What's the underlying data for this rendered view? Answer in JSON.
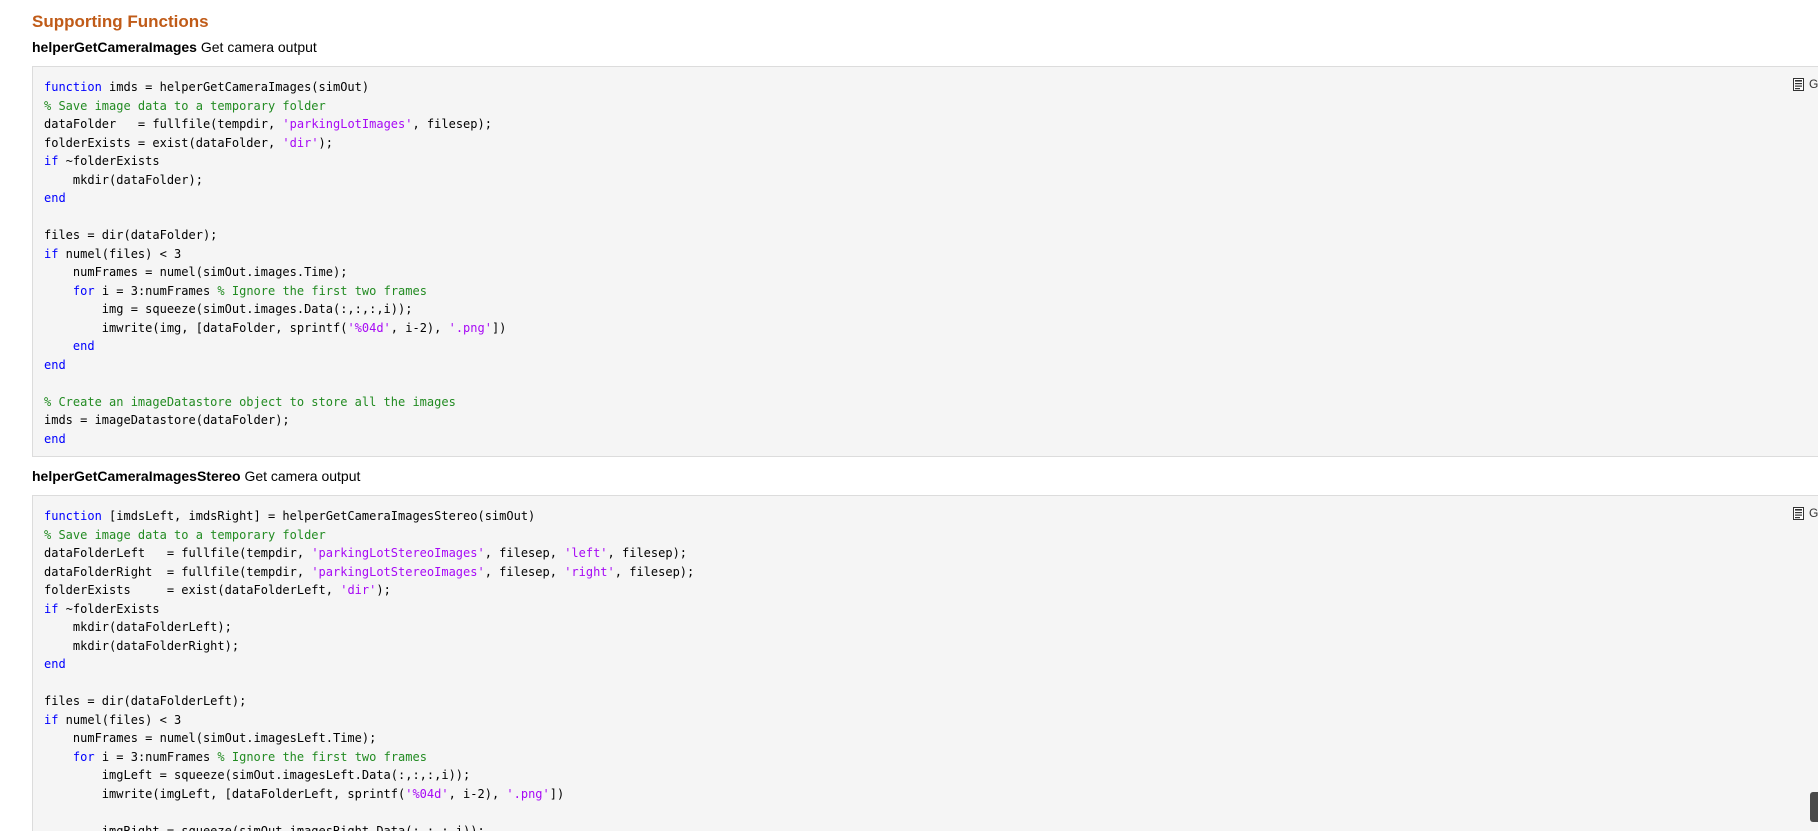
{
  "section_title": "Supporting Functions",
  "functions": [
    {
      "name": "helperGetCameraImages",
      "description": "Get camera output",
      "button_label": "Ge",
      "code_lines": [
        [
          {
            "t": "kw",
            "s": "function"
          },
          {
            "t": "plain",
            "s": " imds = helperGetCameraImages(simOut)"
          }
        ],
        [
          {
            "t": "cmt",
            "s": "% Save image data to a temporary folder"
          }
        ],
        [
          {
            "t": "plain",
            "s": "dataFolder   = fullfile(tempdir, "
          },
          {
            "t": "str",
            "s": "'parkingLotImages'"
          },
          {
            "t": "plain",
            "s": ", filesep);"
          }
        ],
        [
          {
            "t": "plain",
            "s": "folderExists = exist(dataFolder, "
          },
          {
            "t": "str",
            "s": "'dir'"
          },
          {
            "t": "plain",
            "s": ");"
          }
        ],
        [
          {
            "t": "kw",
            "s": "if"
          },
          {
            "t": "plain",
            "s": " ~folderExists"
          }
        ],
        [
          {
            "t": "plain",
            "s": "    mkdir(dataFolder);"
          }
        ],
        [
          {
            "t": "kw",
            "s": "end"
          }
        ],
        [],
        [
          {
            "t": "plain",
            "s": "files = dir(dataFolder);"
          }
        ],
        [
          {
            "t": "kw",
            "s": "if"
          },
          {
            "t": "plain",
            "s": " numel(files) < 3"
          }
        ],
        [
          {
            "t": "plain",
            "s": "    numFrames = numel(simOut.images.Time);"
          }
        ],
        [
          {
            "t": "plain",
            "s": "    "
          },
          {
            "t": "kw",
            "s": "for"
          },
          {
            "t": "plain",
            "s": " i = 3:numFrames "
          },
          {
            "t": "cmt",
            "s": "% Ignore the first two frames"
          }
        ],
        [
          {
            "t": "plain",
            "s": "        img = squeeze(simOut.images.Data(:,:,:,i));"
          }
        ],
        [
          {
            "t": "plain",
            "s": "        imwrite(img, [dataFolder, sprintf("
          },
          {
            "t": "str",
            "s": "'%04d'"
          },
          {
            "t": "plain",
            "s": ", i-2), "
          },
          {
            "t": "str",
            "s": "'.png'"
          },
          {
            "t": "plain",
            "s": "])"
          }
        ],
        [
          {
            "t": "plain",
            "s": "    "
          },
          {
            "t": "kw",
            "s": "end"
          }
        ],
        [
          {
            "t": "kw",
            "s": "end"
          }
        ],
        [],
        [
          {
            "t": "cmt",
            "s": "% Create an imageDatastore object to store all the images"
          }
        ],
        [
          {
            "t": "plain",
            "s": "imds = imageDatastore(dataFolder);"
          }
        ],
        [
          {
            "t": "kw",
            "s": "end"
          }
        ]
      ]
    },
    {
      "name": "helperGetCameraImagesStereo",
      "description": "Get camera output",
      "button_label": "Ge",
      "code_lines": [
        [
          {
            "t": "kw",
            "s": "function"
          },
          {
            "t": "plain",
            "s": " [imdsLeft, imdsRight] = helperGetCameraImagesStereo(simOut)"
          }
        ],
        [
          {
            "t": "cmt",
            "s": "% Save image data to a temporary folder"
          }
        ],
        [
          {
            "t": "plain",
            "s": "dataFolderLeft   = fullfile(tempdir, "
          },
          {
            "t": "str",
            "s": "'parkingLotStereoImages'"
          },
          {
            "t": "plain",
            "s": ", filesep, "
          },
          {
            "t": "str",
            "s": "'left'"
          },
          {
            "t": "plain",
            "s": ", filesep);"
          }
        ],
        [
          {
            "t": "plain",
            "s": "dataFolderRight  = fullfile(tempdir, "
          },
          {
            "t": "str",
            "s": "'parkingLotStereoImages'"
          },
          {
            "t": "plain",
            "s": ", filesep, "
          },
          {
            "t": "str",
            "s": "'right'"
          },
          {
            "t": "plain",
            "s": ", filesep);"
          }
        ],
        [
          {
            "t": "plain",
            "s": "folderExists     = exist(dataFolderLeft, "
          },
          {
            "t": "str",
            "s": "'dir'"
          },
          {
            "t": "plain",
            "s": ");"
          }
        ],
        [
          {
            "t": "kw",
            "s": "if"
          },
          {
            "t": "plain",
            "s": " ~folderExists"
          }
        ],
        [
          {
            "t": "plain",
            "s": "    mkdir(dataFolderLeft);"
          }
        ],
        [
          {
            "t": "plain",
            "s": "    mkdir(dataFolderRight);"
          }
        ],
        [
          {
            "t": "kw",
            "s": "end"
          }
        ],
        [],
        [
          {
            "t": "plain",
            "s": "files = dir(dataFolderLeft);"
          }
        ],
        [
          {
            "t": "kw",
            "s": "if"
          },
          {
            "t": "plain",
            "s": " numel(files) < 3"
          }
        ],
        [
          {
            "t": "plain",
            "s": "    numFrames = numel(simOut.imagesLeft.Time);"
          }
        ],
        [
          {
            "t": "plain",
            "s": "    "
          },
          {
            "t": "kw",
            "s": "for"
          },
          {
            "t": "plain",
            "s": " i = 3:numFrames "
          },
          {
            "t": "cmt",
            "s": "% Ignore the first two frames"
          }
        ],
        [
          {
            "t": "plain",
            "s": "        imgLeft = squeeze(simOut.imagesLeft.Data(:,:,:,i));"
          }
        ],
        [
          {
            "t": "plain",
            "s": "        imwrite(imgLeft, [dataFolderLeft, sprintf("
          },
          {
            "t": "str",
            "s": "'%04d'"
          },
          {
            "t": "plain",
            "s": ", i-2), "
          },
          {
            "t": "str",
            "s": "'.png'"
          },
          {
            "t": "plain",
            "s": "])"
          }
        ],
        [],
        [
          {
            "t": "plain",
            "s": "        imgRight = squeeze(simOut.imagesRight.Data(:,:,:,i));"
          }
        ]
      ]
    }
  ],
  "icons": {
    "get_button": "document-icon"
  },
  "colors": {
    "section_title": "#c05b18",
    "keyword": "#0000ff",
    "string": "#a709f5",
    "comment": "#228b22",
    "code_background": "#f5f5f5"
  }
}
